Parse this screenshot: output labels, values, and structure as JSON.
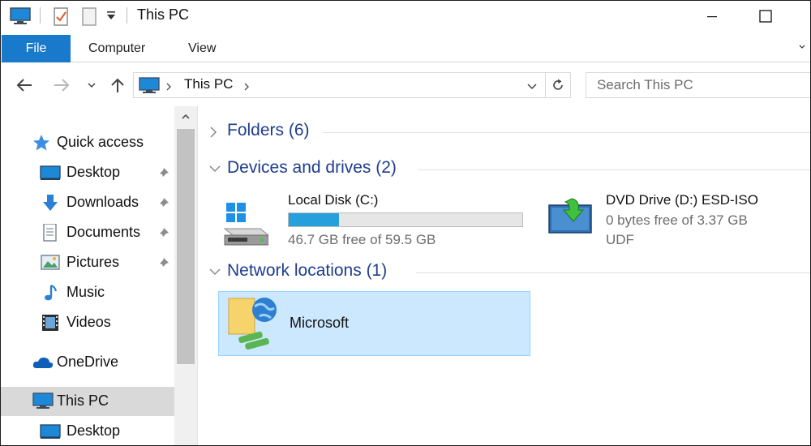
{
  "window": {
    "title": "This PC"
  },
  "ribbon": {
    "tabs": [
      "File",
      "Computer",
      "View"
    ]
  },
  "address": {
    "location": "This PC"
  },
  "search": {
    "placeholder": "Search This PC"
  },
  "sidebar": {
    "quick_access": "Quick access",
    "pinned": [
      {
        "label": "Desktop",
        "icon": "desktop-icon"
      },
      {
        "label": "Downloads",
        "icon": "downloads-icon"
      },
      {
        "label": "Documents",
        "icon": "documents-icon"
      },
      {
        "label": "Pictures",
        "icon": "pictures-icon"
      }
    ],
    "others": [
      {
        "label": "Music",
        "icon": "music-icon"
      },
      {
        "label": "Videos",
        "icon": "videos-icon"
      }
    ],
    "onedrive": "OneDrive",
    "this_pc": "This PC",
    "this_pc_child": "Desktop"
  },
  "groups": {
    "folders": "Folders (6)",
    "devices": "Devices and drives (2)",
    "network": "Network locations (1)"
  },
  "drives": {
    "c": {
      "name": "Local Disk (C:)",
      "free": "46.7 GB free of 59.5 GB",
      "used_fraction": 0.215
    },
    "d": {
      "name": "DVD Drive (D:) ESD-ISO",
      "free": "0 bytes free of 3.37 GB",
      "fs": "UDF"
    }
  },
  "network_items": [
    {
      "label": "Microsoft"
    }
  ],
  "colors": {
    "accent": "#1979ca",
    "group_title": "#1e3d8f",
    "drive_bar": "#26a0da",
    "selection": "#cce8ff"
  }
}
